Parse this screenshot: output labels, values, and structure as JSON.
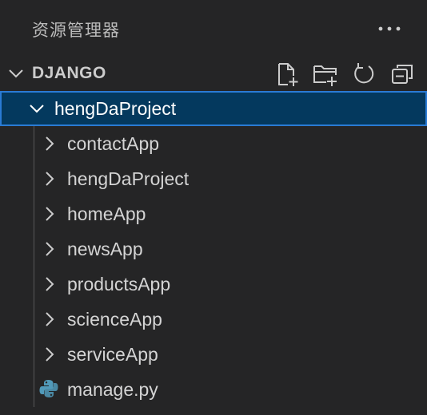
{
  "panel": {
    "title": "资源管理器",
    "more_icon": "ellipsis-icon"
  },
  "section": {
    "title": "DJANGO",
    "actions": [
      {
        "name": "new-file",
        "icon": "new-file-icon"
      },
      {
        "name": "new-folder",
        "icon": "new-folder-icon"
      },
      {
        "name": "refresh",
        "icon": "refresh-icon"
      },
      {
        "name": "collapse-all",
        "icon": "collapse-all-icon"
      }
    ]
  },
  "tree": {
    "root": {
      "label": "hengDaProject",
      "expanded": true,
      "selected": true
    },
    "children": [
      {
        "label": "contactApp",
        "type": "folder"
      },
      {
        "label": "hengDaProject",
        "type": "folder"
      },
      {
        "label": "homeApp",
        "type": "folder"
      },
      {
        "label": "newsApp",
        "type": "folder"
      },
      {
        "label": "productsApp",
        "type": "folder"
      },
      {
        "label": "scienceApp",
        "type": "folder"
      },
      {
        "label": "serviceApp",
        "type": "folder"
      },
      {
        "label": "manage.py",
        "type": "python-file"
      }
    ]
  },
  "colors": {
    "background": "#252526",
    "selection_bg": "#04395e",
    "selection_border": "#2a7bd4",
    "python_blue": "#519aba"
  }
}
